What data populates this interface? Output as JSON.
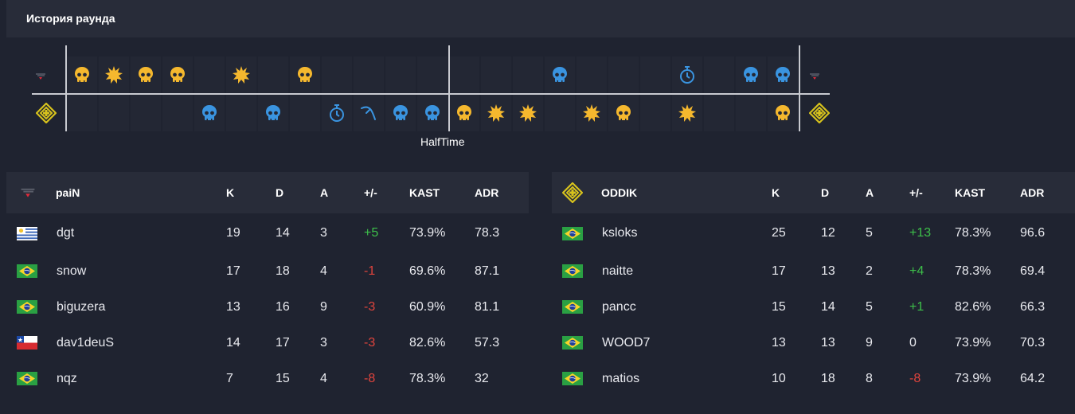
{
  "header": {
    "title": "История раунда"
  },
  "round_history": {
    "halftime_label": "HalfTime",
    "top_team": "paiN",
    "bottom_team": "ODDIK",
    "top_rounds": [
      "skull",
      "explode",
      "skull",
      "skull",
      "",
      "explode",
      "",
      "skull",
      "",
      "",
      "",
      "",
      "",
      "",
      "",
      "",
      "",
      "",
      "",
      "",
      "",
      "",
      "",
      "",
      "",
      "",
      "",
      "",
      "",
      "",
      "",
      "",
      ""
    ],
    "bottom_rounds": [],
    "colors": {
      "gold": "#f5b82e",
      "blue": "#3a94e0"
    }
  },
  "team1": {
    "name": "paiN",
    "headers": {
      "k": "K",
      "d": "D",
      "a": "A",
      "pm": "+/-",
      "kast": "KAST",
      "adr": "ADR"
    },
    "players": [
      {
        "name": "dgt",
        "flag": "uruguay-flag",
        "k": "19",
        "d": "14",
        "a": "3",
        "pm": "+5",
        "kast": "73.9%",
        "adr": "78.3"
      },
      {
        "name": "snow",
        "flag": "brazil-flag",
        "k": "17",
        "d": "18",
        "a": "4",
        "pm": "-1",
        "kast": "69.6%",
        "adr": "87.1"
      },
      {
        "name": "biguzera",
        "flag": "brazil-flag",
        "k": "13",
        "d": "16",
        "a": "9",
        "pm": "-3",
        "kast": "60.9%",
        "adr": "81.1"
      },
      {
        "name": "dav1deuS",
        "flag": "chile-flag",
        "k": "14",
        "d": "17",
        "a": "3",
        "pm": "-3",
        "kast": "82.6%",
        "adr": "57.3"
      },
      {
        "name": "nqz",
        "flag": "brazil-flag",
        "k": "7",
        "d": "15",
        "a": "4",
        "pm": "-8",
        "kast": "78.3%",
        "adr": "32"
      }
    ]
  },
  "team2": {
    "name": "ODDIK",
    "headers": {
      "k": "K",
      "d": "D",
      "a": "A",
      "pm": "+/-",
      "kast": "KAST",
      "adr": "ADR"
    },
    "players": [
      {
        "name": "ksloks",
        "flag": "brazil-flag",
        "k": "25",
        "d": "12",
        "a": "5",
        "pm": "+13",
        "kast": "78.3%",
        "adr": "96.6"
      },
      {
        "name": "naitte",
        "flag": "brazil-flag",
        "k": "17",
        "d": "13",
        "a": "2",
        "pm": "+4",
        "kast": "78.3%",
        "adr": "69.4"
      },
      {
        "name": "pancc",
        "flag": "brazil-flag",
        "k": "15",
        "d": "14",
        "a": "5",
        "pm": "+1",
        "kast": "82.6%",
        "adr": "66.3"
      },
      {
        "name": "WOOD7",
        "flag": "brazil-flag",
        "k": "13",
        "d": "13",
        "a": "9",
        "pm": "0",
        "kast": "73.9%",
        "adr": "70.3"
      },
      {
        "name": "matios",
        "flag": "brazil-flag",
        "k": "10",
        "d": "18",
        "a": "8",
        "pm": "-8",
        "kast": "73.9%",
        "adr": "64.2"
      }
    ]
  }
}
